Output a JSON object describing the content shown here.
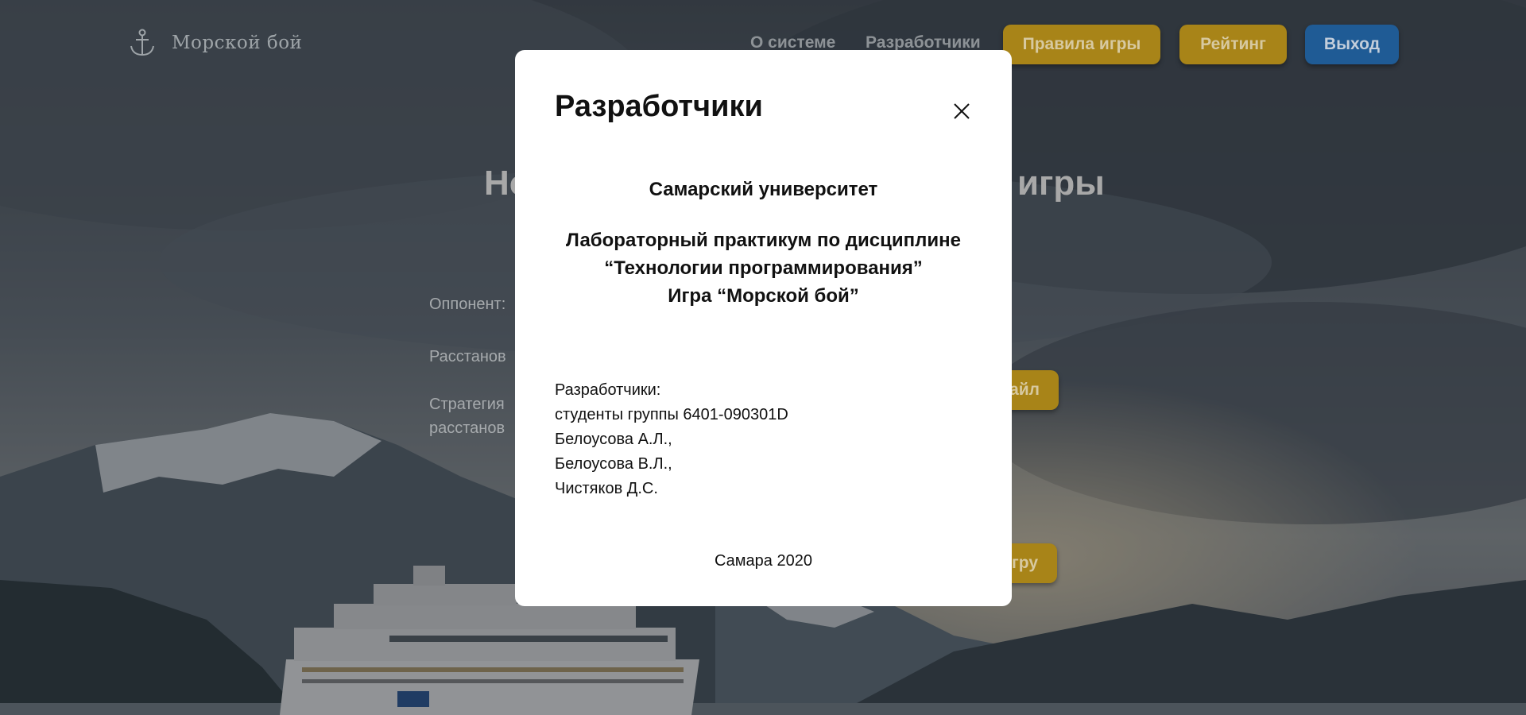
{
  "header": {
    "logo_text": "Морской бой",
    "nav": {
      "about": "О системе",
      "developers": "Разработчики"
    },
    "buttons": {
      "rules": "Правила игры",
      "rating": "Рейтинг",
      "logout": "Выход"
    }
  },
  "background": {
    "title_left": "Но",
    "title_right": "игры",
    "labels": {
      "opponent": "Оппонент:",
      "placement": "Расстанов",
      "strategy_line1": "Стратегия",
      "strategy_line2": "расстанов"
    },
    "buttons": {
      "file": "айл",
      "start": "гру"
    }
  },
  "modal": {
    "title": "Разработчики",
    "university": "Самарский университет",
    "course_line1": "Лабораторный практикум по дисциплине",
    "course_line2": "“Технологии программирования”",
    "course_line3": "Игра “Морской бой”",
    "developers_heading": "Разработчики:",
    "group": "студенты группы 6401-090301D",
    "dev1": "Белоусова А.Л.,",
    "dev2": "Белоусова В.Л.,",
    "dev3": "Чистяков Д.С.",
    "footer": "Самара 2020"
  },
  "colors": {
    "accent_yellow": "#a88418",
    "accent_blue": "#1f5b95",
    "modal_bg": "#ffffff",
    "overlay": "#2a2e34"
  },
  "icons": {
    "logo": "anchor-icon",
    "close": "close-icon"
  }
}
